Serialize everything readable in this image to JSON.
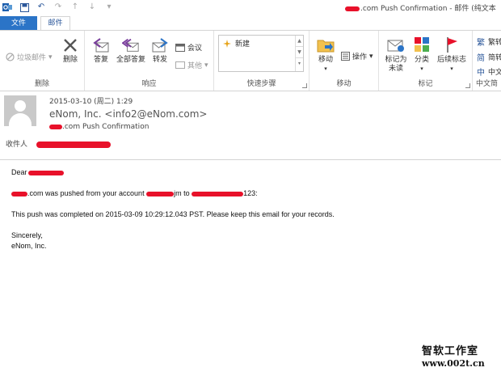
{
  "titlebar": {
    "title": ".com Push Confirmation - 邮件 (纯文本"
  },
  "tabs": [
    {
      "label": "文件"
    },
    {
      "label": "邮件"
    }
  ],
  "ribbon": {
    "delete_group": {
      "junk": "垃圾邮件",
      "delete": "删除",
      "label": "删除"
    },
    "respond_group": {
      "reply": "答复",
      "reply_all": "全部答复",
      "forward": "转发",
      "meeting": "会议",
      "more": "其他",
      "label": "响应"
    },
    "quick_steps_group": {
      "item": "新建",
      "label": "快速步骤"
    },
    "move_group": {
      "move": "移动",
      "actions": "操作",
      "label": "移动"
    },
    "tags_group": {
      "mark_unread_line1": "标记为",
      "mark_unread_line2": "未读",
      "categorize": "分类",
      "follow_up": "后续标志",
      "label": "标记"
    },
    "chinese_group": {
      "to_traditional": "繁转",
      "to_simplified": "简转",
      "convert": "中文",
      "label": "中文简"
    }
  },
  "header": {
    "date": "2015-03-10 (周二) 1:29",
    "from": "eNom, Inc. <info2@eNom.com>",
    "subject": ".com Push Confirmation",
    "to_label": "收件人"
  },
  "body": {
    "greeting": "Dear",
    "line1_a": ".com was pushed from your account",
    "line1_b": "jm to",
    "line1_c": "123:",
    "line2": "This push was completed on 2015-03-09 10:29:12.043 PST.       Please keep this email for your records.",
    "sign1": "Sincerely,",
    "sign2": "eNom, Inc."
  },
  "watermark": {
    "line1": "智软工作室",
    "line2": "www.002t.cn"
  },
  "colors": {
    "accent": "#2b74c7",
    "redaction": "#e8112a",
    "avatar_bg": "#c9c9c9"
  }
}
